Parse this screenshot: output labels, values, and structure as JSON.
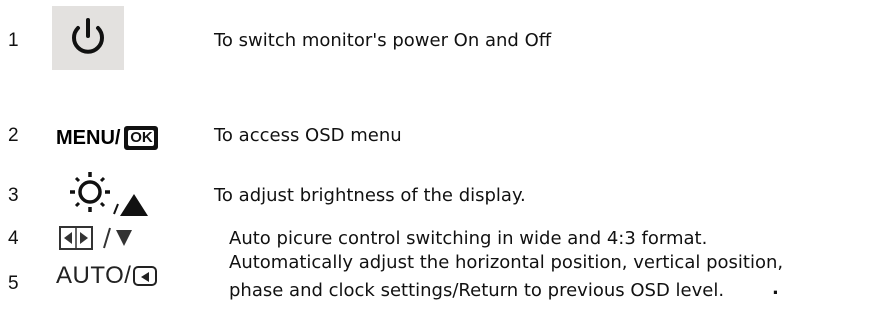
{
  "items": [
    {
      "number": "1",
      "icon": "power-icon",
      "description": "To switch monitor's power On and Off"
    },
    {
      "number": "2",
      "icon_label": "MENU/",
      "badge": "OK",
      "description": "To access OSD menu"
    },
    {
      "number": "3",
      "icon": "brightness-sun-up-arrow-icon",
      "description": "To adjust brightness of the display."
    },
    {
      "number": "4",
      "icon": "aspect-ratio-down-arrow-icon",
      "description": "Auto picure control switching in wide and 4:3 format."
    },
    {
      "number": "5",
      "icon_label": "AUTO/",
      "icon": "return-icon",
      "description_line1": "Automatically adjust the horizontal position, vertical position,",
      "description_line2": "phase and clock settings/Return to previous OSD level.",
      "trailing": "."
    }
  ]
}
